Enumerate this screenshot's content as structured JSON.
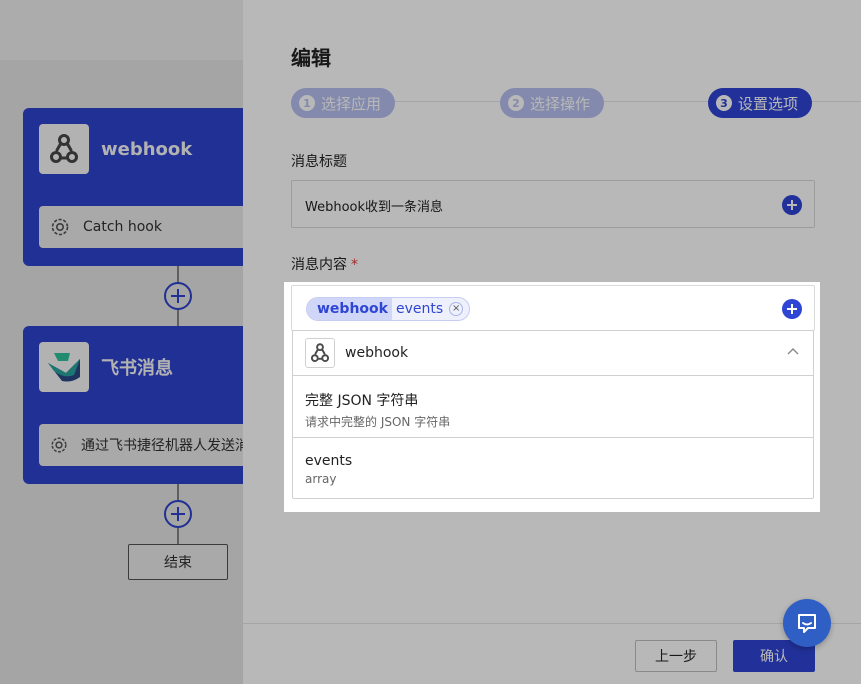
{
  "canvas": {
    "nodes": [
      {
        "title": "webhook",
        "action": "Catch hook",
        "icon": "webhook-icon"
      },
      {
        "title": "飞书消息",
        "action": "通过飞书捷径机器人发送消息",
        "icon": "feishu-icon"
      }
    ],
    "end_label": "结束"
  },
  "panel": {
    "title": "编辑",
    "steps": [
      {
        "num": "1",
        "label": "选择应用",
        "state": "done"
      },
      {
        "num": "2",
        "label": "选择操作",
        "state": "done"
      },
      {
        "num": "3",
        "label": "设置选项",
        "state": "active"
      }
    ],
    "message_title": {
      "label": "消息标题",
      "value": "Webhook收到一条消息"
    },
    "message_content": {
      "label": "消息内容",
      "required_mark": "*",
      "tag_app": "webhook",
      "tag_field": "events",
      "tag_close": "×"
    },
    "dropdown": {
      "app": "webhook",
      "items": [
        {
          "title": "完整 JSON 字符串",
          "subtitle": "请求中完整的 JSON 字符串"
        },
        {
          "title": "events",
          "subtitle": "array"
        }
      ]
    },
    "buttons": {
      "prev": "上一步",
      "confirm": "确认"
    }
  },
  "colors": {
    "primary": "#2f45d4",
    "step_inactive": "#b6bff0",
    "required": "#e23b3b",
    "fab": "#2f5fc4"
  }
}
